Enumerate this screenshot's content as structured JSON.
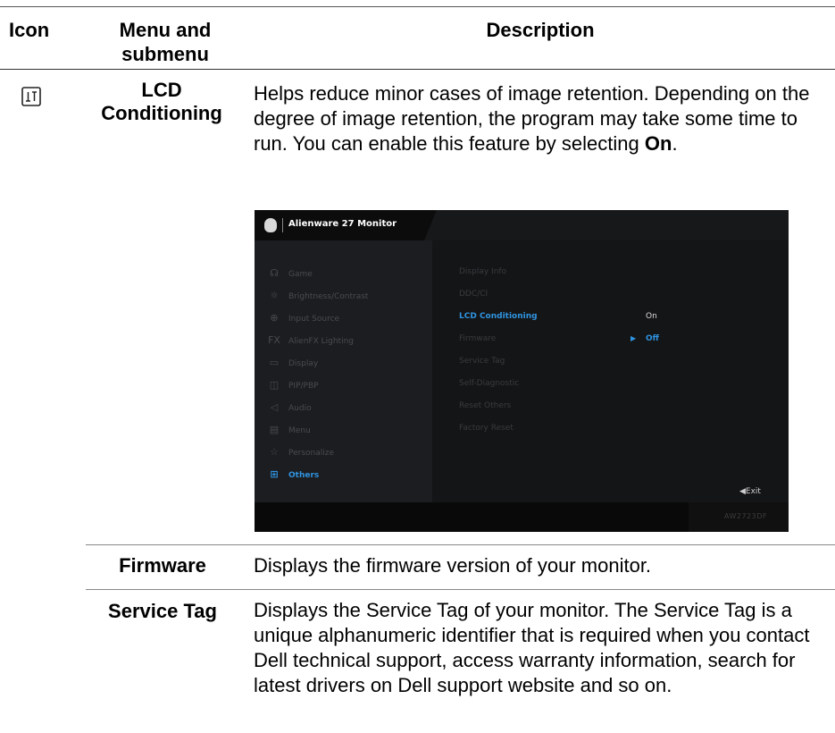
{
  "table": {
    "headers": {
      "icon": "Icon",
      "menu": "Menu and submenu",
      "description": "Description"
    },
    "rows": [
      {
        "menu": "LCD Conditioning",
        "icon": "lcd-conditioning-icon",
        "description_pre": "Helps reduce minor cases of image retention. Depending on the degree of image retention, the program may take some time to run. You can enable this feature by selecting ",
        "description_bold": "On",
        "description_post": "."
      },
      {
        "menu": "Firmware",
        "description": "Displays the firmware version of your monitor."
      },
      {
        "menu": "Service Tag",
        "description": "Displays the Service Tag of your monitor. The Service Tag is a unique alphanumeric identifier that is required when you contact Dell technical support, access warranty information, search for latest drivers on Dell support website and so on."
      }
    ]
  },
  "osd": {
    "title": "Alienware 27 Monitor",
    "model": "AW2723DF",
    "exit_label": "◀Exit",
    "menu": [
      {
        "label": "Game",
        "icon": "gamepad-icon",
        "glyph": "☊"
      },
      {
        "label": "Brightness/Contrast",
        "icon": "brightness-icon",
        "glyph": "☼"
      },
      {
        "label": "Input Source",
        "icon": "input-source-icon",
        "glyph": "⊕"
      },
      {
        "label": "AlienFX Lighting",
        "icon": "alienfx-icon",
        "glyph": "FX"
      },
      {
        "label": "Display",
        "icon": "display-icon",
        "glyph": "▭"
      },
      {
        "label": "PIP/PBP",
        "icon": "pip-pbp-icon",
        "glyph": "◫"
      },
      {
        "label": "Audio",
        "icon": "audio-icon",
        "glyph": "◁"
      },
      {
        "label": "Menu",
        "icon": "menu-icon",
        "glyph": "▤"
      },
      {
        "label": "Personalize",
        "icon": "star-icon",
        "glyph": "☆"
      },
      {
        "label": "Others",
        "icon": "others-icon",
        "glyph": "⊞"
      }
    ],
    "submenu": [
      "Display Info",
      "DDC/CI",
      "LCD Conditioning",
      "Firmware",
      "Service Tag",
      "Self-Diagnostic",
      "Reset Others",
      "Factory Reset"
    ],
    "options": {
      "on": "On",
      "off": "Off",
      "pointer": "▶"
    }
  },
  "colors": {
    "accent": "#2f94e0",
    "osd_bg": "#17181a"
  }
}
